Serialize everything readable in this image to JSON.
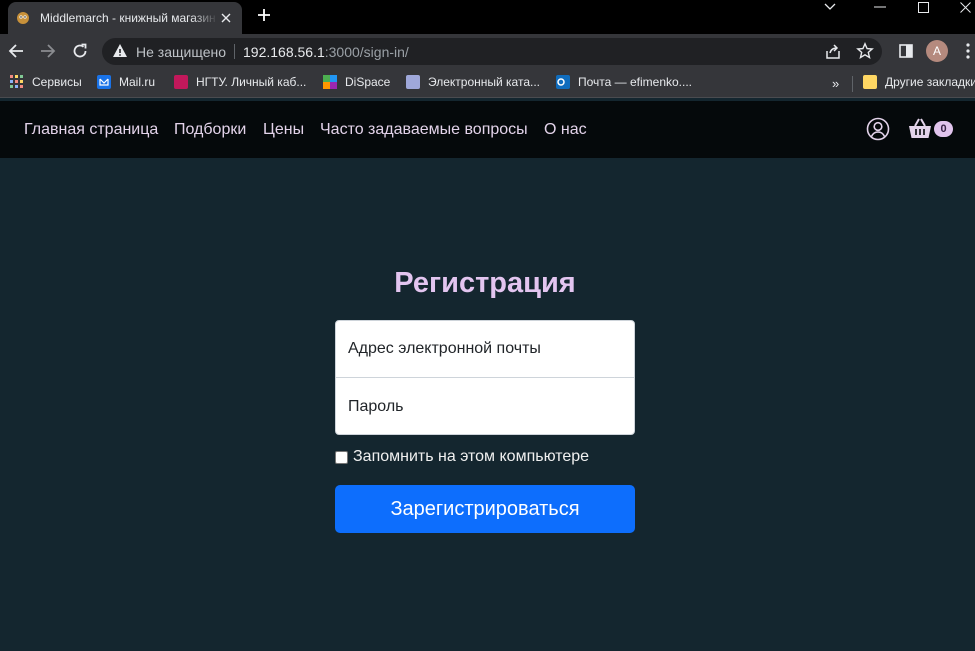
{
  "browser": {
    "tab_title": "Middlemarch - книжный магазин",
    "security_label": "Не защищено",
    "url_host": "192.168.56.1",
    "url_rest": ":3000/sign-in/",
    "profile_initial": "A",
    "bookmarks": [
      {
        "label": "Сервисы",
        "color": "#f28b82"
      },
      {
        "label": "Mail.ru",
        "color": "#1a73e8"
      },
      {
        "label": "НГТУ. Личный каб...",
        "color": "#c2185b"
      },
      {
        "label": "DiSpace",
        "color": "#4caf50"
      },
      {
        "label": "Электронный ката...",
        "color": "#9fa8da"
      },
      {
        "label": "Почта — efimenko....",
        "color": "#0f6cbd"
      }
    ],
    "bookmarks_more": "»",
    "other_bookmarks": "Другие закладки"
  },
  "site": {
    "nav": [
      "Главная страница",
      "Подборки",
      "Цены",
      "Часто задаваемые вопросы",
      "О нас"
    ],
    "cart_count": "0"
  },
  "form": {
    "title": "Регистрация",
    "email_placeholder": "Адрес электронной почты",
    "password_placeholder": "Пароль",
    "remember_label": "Запомнить на этом компьютере",
    "submit_label": "Зарегистрироваться"
  }
}
